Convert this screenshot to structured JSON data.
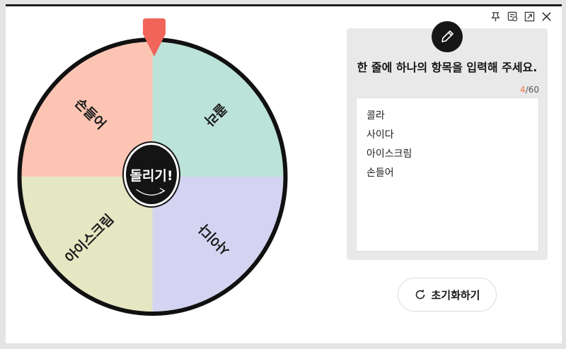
{
  "window": {
    "icons": [
      "pin-icon",
      "save-icon",
      "expand-icon",
      "close-icon"
    ]
  },
  "wheel": {
    "segments": [
      {
        "label": "콜라",
        "color": "#bce3d9"
      },
      {
        "label": "사이다",
        "color": "#d4d4f2"
      },
      {
        "label": "아이스크림",
        "color": "#e5e6c2"
      },
      {
        "label": "손들어",
        "color": "#fcc5b3"
      }
    ],
    "pointer_color": "#f0645a",
    "spin_label": "돌리기!"
  },
  "panel": {
    "title": "한 줄에 하나의 항목을 입력해 주세요.",
    "count_current": "4",
    "count_max": "/60",
    "items": [
      "콜라",
      "사이다",
      "아이스크림",
      "손들어"
    ]
  },
  "reset": {
    "label": "초기화하기"
  }
}
